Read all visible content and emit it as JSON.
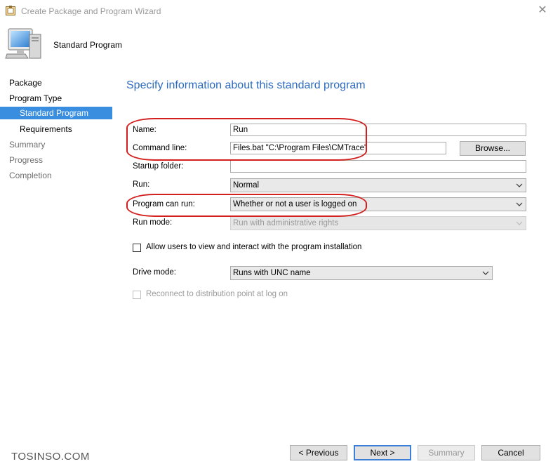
{
  "window": {
    "title": "Create Package and Program Wizard",
    "close_glyph": "✕"
  },
  "header": {
    "title": "Standard Program",
    "icon": "computer-icon"
  },
  "nav": {
    "items": [
      {
        "label": "Package"
      },
      {
        "label": "Program Type"
      },
      {
        "label": "Standard Program"
      },
      {
        "label": "Requirements"
      },
      {
        "label": "Summary"
      },
      {
        "label": "Progress"
      },
      {
        "label": "Completion"
      }
    ]
  },
  "main": {
    "heading": "Specify information about this standard program",
    "name_label": "Name:",
    "name_value": "Run",
    "command_label": "Command line:",
    "command_value": "Files.bat \"C:\\Program Files\\CMTrace\"",
    "browse_label": "Browse...",
    "startup_label": "Startup folder:",
    "startup_value": "",
    "run_label": "Run:",
    "run_value": "Normal",
    "can_run_label": "Program can run:",
    "can_run_value": "Whether or not a user is logged on",
    "run_mode_label": "Run mode:",
    "run_mode_value": "Run with administrative rights",
    "allow_interact_label": "Allow users to view and interact with the program installation",
    "drive_mode_label": "Drive mode:",
    "drive_mode_value": "Runs with UNC name",
    "reconnect_label": "Reconnect to distribution point at log on"
  },
  "buttons": {
    "previous": "< Previous",
    "next": "Next >",
    "summary": "Summary",
    "cancel": "Cancel"
  },
  "watermark": "TOSINSO.COM",
  "colors": {
    "accent": "#3a8ee0",
    "heading": "#2c6bbf",
    "highlight_ring": "#d3201f"
  }
}
